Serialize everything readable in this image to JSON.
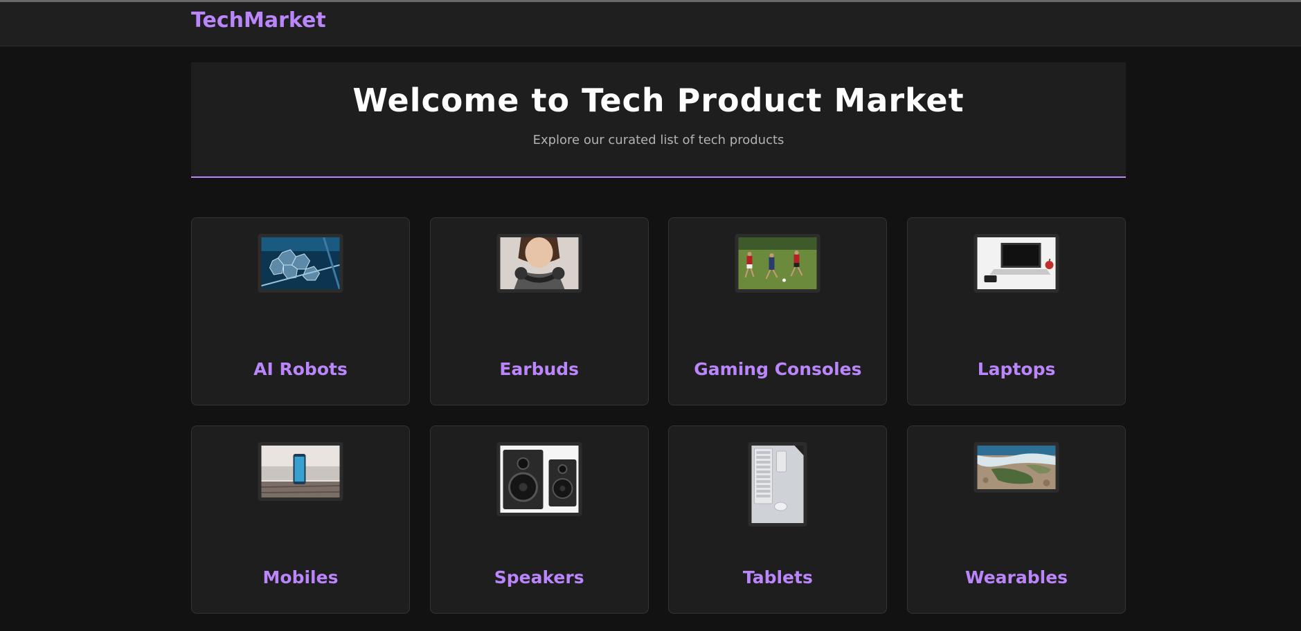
{
  "nav": {
    "brand": "TechMarket"
  },
  "hero": {
    "title": "Welcome to Tech Product Market",
    "subtitle": "Explore our curated list of tech products"
  },
  "colors": {
    "accent": "#bb86fc",
    "background": "#121212",
    "surface": "#1e1e1e"
  },
  "categories": [
    {
      "label": "AI Robots",
      "icon": "robot-telescope-image"
    },
    {
      "label": "Earbuds",
      "icon": "headphones-image"
    },
    {
      "label": "Gaming Consoles",
      "icon": "soccer-players-image"
    },
    {
      "label": "Laptops",
      "icon": "laptop-image"
    },
    {
      "label": "Mobiles",
      "icon": "smartphone-image"
    },
    {
      "label": "Speakers",
      "icon": "speakers-image"
    },
    {
      "label": "Tablets",
      "icon": "keyboard-mouse-image"
    },
    {
      "label": "Wearables",
      "icon": "coastline-image"
    }
  ]
}
